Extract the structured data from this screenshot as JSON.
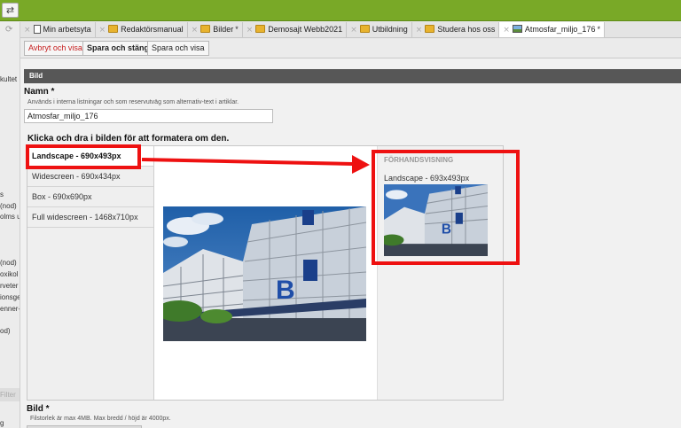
{
  "toggle_glyph": "⇄",
  "sidebar": {
    "refresh_glyph": "⟳",
    "fragments": [
      "kultet",
      "s",
      "(nod)",
      "olms u",
      "(nod)",
      "oxikol",
      "rveter",
      "ionsge",
      "enner-",
      "od)"
    ],
    "filter_label": "Filter",
    "bottom_fragment": "g"
  },
  "tabs": [
    {
      "label": "Min arbetsyta",
      "icon": "document-icon",
      "modified": false
    },
    {
      "label": "Redaktörsmanual",
      "icon": "folder-icon",
      "modified": false
    },
    {
      "label": "Bilder",
      "icon": "folder-icon",
      "modified": true
    },
    {
      "label": "Demosajt Webb2021",
      "icon": "site-icon",
      "modified": false
    },
    {
      "label": "Utbildning",
      "icon": "folder-icon",
      "modified": false
    },
    {
      "label": "Studera hos oss",
      "icon": "folder-icon",
      "modified": false
    },
    {
      "label": "Atmosfar_miljo_176",
      "icon": "image-icon",
      "modified": true
    }
  ],
  "close_glyph": "×",
  "modified_glyph": "*",
  "toolbar": {
    "cancel_label": "Avbryt och visa",
    "save_close_label": "Spara och stäng",
    "save_view_label": "Spara och visa"
  },
  "section_title": "Bild",
  "name_field": {
    "label": "Namn *",
    "help": "Används i interna listningar och som reservutväg som alternativ-text i artiklar.",
    "value": "Atmosfar_miljo_176"
  },
  "crop": {
    "instruction": "Klicka och dra i bilden för att formatera om den.",
    "formats": [
      "Landscape - 690x493px",
      "Widescreen - 690x434px",
      "Box - 690x690px",
      "Full widescreen - 1468x710px"
    ],
    "selected_index": 0,
    "preview_title": "FÖRHANDSVISNING",
    "preview_size": "Landscape - 693x493px"
  },
  "file_field": {
    "label": "Bild *",
    "help": "Filstorlek är max 4MB. Max bredd / höjd är 4000px."
  },
  "colors": {
    "topbar": "#79a927",
    "highlight": "#ee1111",
    "section_bar": "#575757",
    "cancel_text": "#c62020"
  }
}
